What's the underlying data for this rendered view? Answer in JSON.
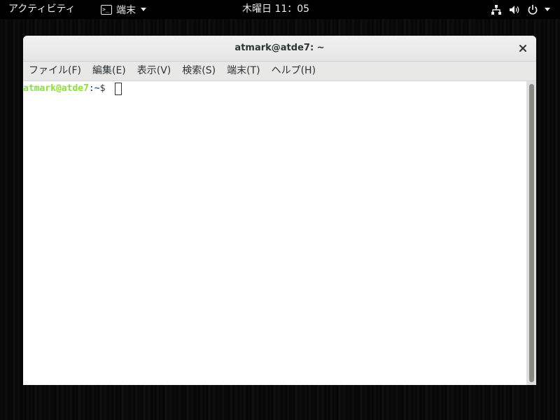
{
  "topbar": {
    "activities_label": "アクティビティ",
    "app_menu_label": "端末",
    "clock": "木曜日 11：05",
    "icons": [
      "network-icon",
      "volume-icon",
      "power-icon",
      "chevron-down-icon"
    ]
  },
  "window": {
    "title": "atmark@atde7: ~",
    "menu": [
      "ファイル(F)",
      "編集(E)",
      "表示(V)",
      "検索(S)",
      "端末(T)",
      "ヘルプ(H)"
    ],
    "prompt": {
      "user_host": "atmark@atde7",
      "separator": ":",
      "path": "~",
      "symbol": "$ "
    }
  },
  "colors": {
    "prompt_user": "#8ae234",
    "prompt_path": "#3465a4",
    "text": "#2e3436",
    "topbar_bg": "#000000",
    "menubar_bg": "#e8e8e7"
  }
}
